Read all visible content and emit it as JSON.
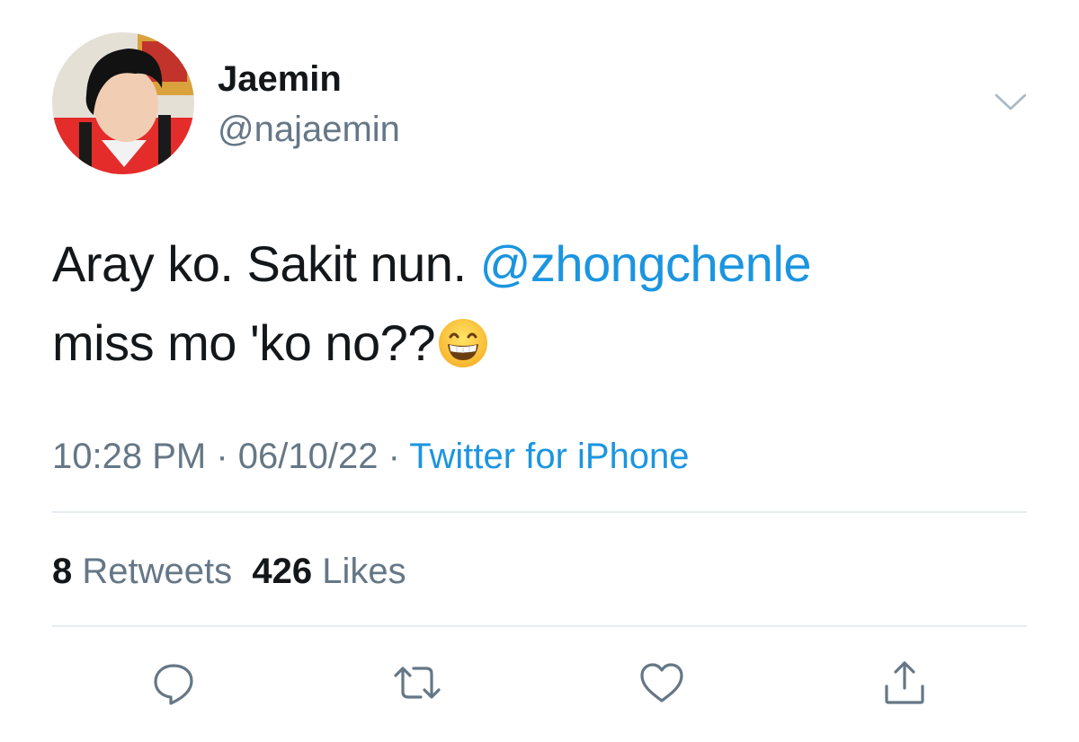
{
  "author": {
    "display_name": "Jaemin",
    "handle": "@najaemin"
  },
  "tweet": {
    "text_part1": "Aray ko. Sakit nun. ",
    "mention": "@zhongchenle",
    "text_part2": "miss mo 'ko no??",
    "emoji": "grinning-face-with-smiling-eyes"
  },
  "meta": {
    "time": "10:28 PM",
    "separator": " · ",
    "date": "06/10/22",
    "source": "Twitter for iPhone"
  },
  "stats": {
    "retweets_count": "8",
    "retweets_label": "Retweets",
    "likes_count": "426",
    "likes_label": "Likes"
  },
  "actions": [
    "reply-icon",
    "retweet-icon",
    "like-icon",
    "share-icon"
  ],
  "colors": {
    "text": "#14171a",
    "secondary": "#657786",
    "link": "#1b95e0",
    "divider": "#e6ecf0"
  }
}
